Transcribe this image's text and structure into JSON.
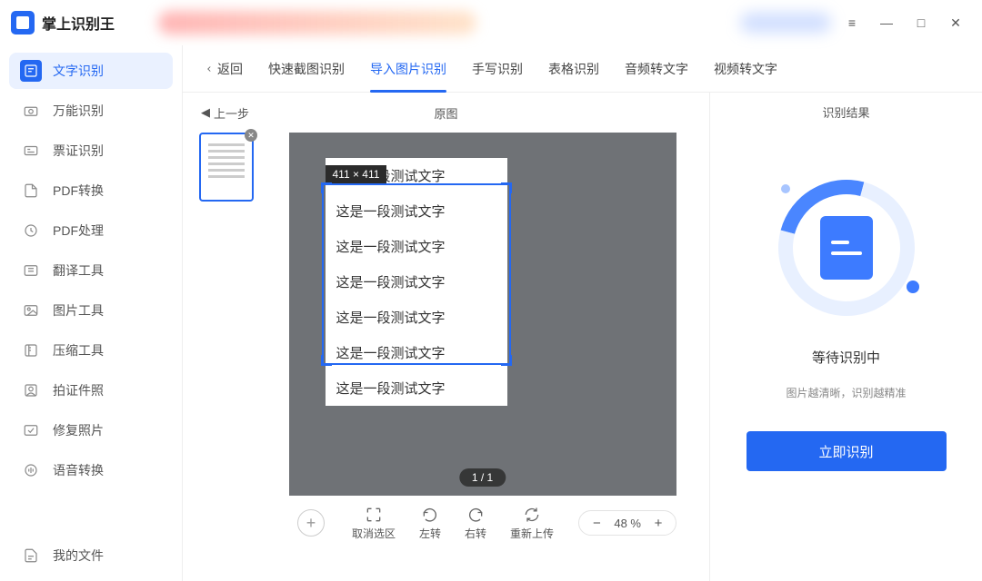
{
  "app": {
    "title": "掌上识别王"
  },
  "window": {
    "menu": "≡",
    "min": "—",
    "max": "□",
    "close": "✕"
  },
  "sidebar": {
    "items": [
      {
        "label": "文字识别"
      },
      {
        "label": "万能识别"
      },
      {
        "label": "票证识别"
      },
      {
        "label": "PDF转换"
      },
      {
        "label": "PDF处理"
      },
      {
        "label": "翻译工具"
      },
      {
        "label": "图片工具"
      },
      {
        "label": "压缩工具"
      },
      {
        "label": "拍证件照"
      },
      {
        "label": "修复照片"
      },
      {
        "label": "语音转换"
      }
    ],
    "footer": {
      "label": "我的文件"
    }
  },
  "tabs": {
    "back": "返回",
    "items": [
      {
        "label": "快速截图识别"
      },
      {
        "label": "导入图片识别"
      },
      {
        "label": "手写识别"
      },
      {
        "label": "表格识别"
      },
      {
        "label": "音频转文字"
      },
      {
        "label": "视频转文字"
      }
    ]
  },
  "workspace": {
    "prev_step": "上一步",
    "original_label": "原图",
    "selection_dim": "411 × 411",
    "page_indicator": "1 / 1",
    "doc_lines": [
      "这是一段测试文字",
      "这是一段测试文字",
      "这是一段测试文字",
      "这是一段测试文字",
      "这是一段测试文字",
      "这是一段测试文字",
      "这是一段测试文字"
    ]
  },
  "toolbar": {
    "cancel_sel": "取消选区",
    "rotate_left": "左转",
    "rotate_right": "右转",
    "reupload": "重新上传",
    "zoom_minus": "−",
    "zoom_value": "48 %",
    "zoom_plus": "+"
  },
  "result": {
    "title": "识别结果",
    "status": "等待识别中",
    "hint": "图片越清晰，识别越精准",
    "button": "立即识别"
  }
}
